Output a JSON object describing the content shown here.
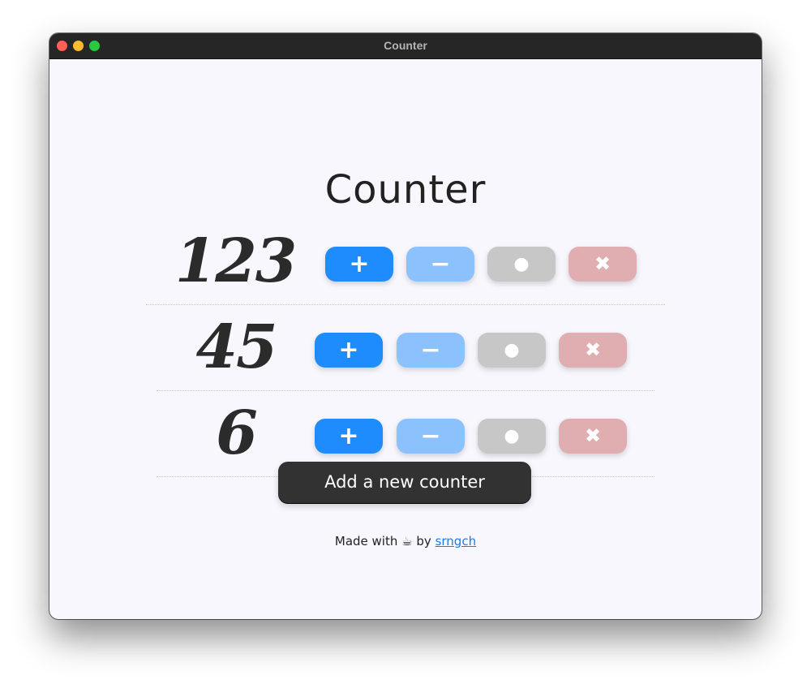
{
  "window": {
    "title": "Counter"
  },
  "app": {
    "heading": "Counter",
    "counters": [
      {
        "value": "123",
        "increment_label": "+",
        "decrement_label": "−",
        "reset_label": "●",
        "delete_label": "✖"
      },
      {
        "value": "45",
        "increment_label": "+",
        "decrement_label": "−",
        "reset_label": "●",
        "delete_label": "✖"
      },
      {
        "value": "6",
        "increment_label": "+",
        "decrement_label": "−",
        "reset_label": "●",
        "delete_label": "✖"
      }
    ],
    "add_button_label": "Add a new counter"
  },
  "footer": {
    "prefix": "Made with",
    "icon": "☕",
    "by": "by",
    "author_link": "srngch"
  },
  "colors": {
    "increment": "#1e8cfc",
    "decrement": "#8bc2fd",
    "reset": "#c7c7c7",
    "delete": "#e0aeb0",
    "add_button": "#323232",
    "background": "#f7f7fd",
    "link": "#1e7be5"
  }
}
